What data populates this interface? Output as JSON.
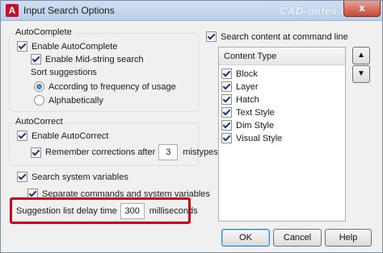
{
  "window": {
    "title": "Input Search Options",
    "app_icon": "A",
    "watermark": "CAD-notes.com",
    "close_glyph": "x"
  },
  "autocomplete": {
    "group_label": "AutoComplete",
    "enable_label": "Enable AutoComplete",
    "enable_checked": true,
    "midstring_label": "Enable Mid-string search",
    "midstring_checked": true,
    "sort_label": "Sort suggestions",
    "sort_options": [
      {
        "label": "According to frequency of usage",
        "selected": true
      },
      {
        "label": "Alphabetically",
        "selected": false
      }
    ]
  },
  "autocorrect": {
    "group_label": "AutoCorrect",
    "enable_label": "Enable AutoCorrect",
    "enable_checked": true,
    "remember_label": "Remember corrections after",
    "remember_checked": true,
    "remember_value": "3",
    "remember_suffix": "mistypes"
  },
  "system_vars": {
    "search_label": "Search system variables",
    "search_checked": true,
    "separate_label": "Separate commands and system variables",
    "separate_checked": true
  },
  "delay": {
    "label": "Suggestion list delay time",
    "value": "300",
    "unit": "milliseconds"
  },
  "content": {
    "search_label": "Search content at command line",
    "search_checked": true,
    "header": "Content Type",
    "items": [
      {
        "label": "Block",
        "checked": true
      },
      {
        "label": "Layer",
        "checked": true
      },
      {
        "label": "Hatch",
        "checked": true
      },
      {
        "label": "Text Style",
        "checked": true
      },
      {
        "label": "Dim Style",
        "checked": true
      },
      {
        "label": "Visual Style",
        "checked": true
      }
    ],
    "up_glyph": "▲",
    "down_glyph": "▼"
  },
  "buttons": {
    "ok": "OK",
    "cancel": "Cancel",
    "help": "Help"
  },
  "colors": {
    "highlight_border": "#d0021b",
    "title_gradient_top": "#cfdff1",
    "close_button": "#c74b36"
  }
}
